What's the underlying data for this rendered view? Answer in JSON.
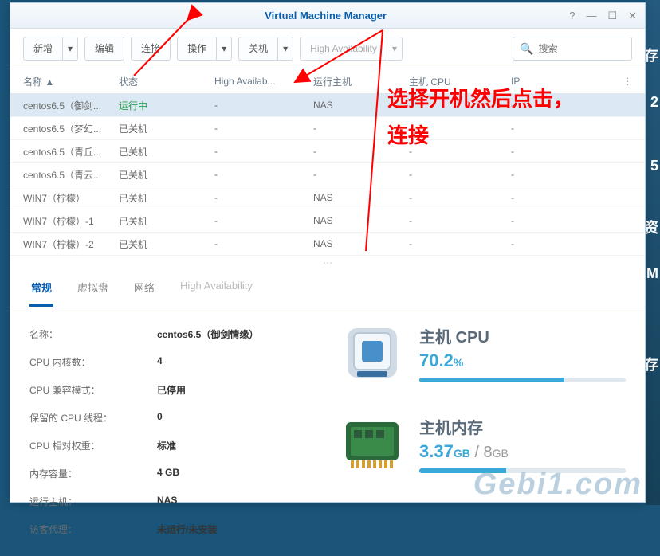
{
  "window": {
    "title": "Virtual Machine Manager"
  },
  "toolbar": {
    "new": "新增",
    "edit": "编辑",
    "connect": "连接",
    "action": "操作",
    "shutdown": "关机",
    "ha": "High Availability",
    "search_placeholder": "搜索"
  },
  "table": {
    "headers": {
      "name": "名称 ▲",
      "state": "状态",
      "ha": "High Availab...",
      "host": "运行主机",
      "cpu": "主机 CPU",
      "ip": "IP",
      "more": "⋮"
    },
    "rows": [
      {
        "name": "centos6.5（御剑...",
        "state": "运行中",
        "running": true,
        "ha": "-",
        "host": "NAS",
        "cpu": "",
        "ip": "-"
      },
      {
        "name": "centos6.5（梦幻...",
        "state": "已关机",
        "running": false,
        "ha": "-",
        "host": "-",
        "cpu": "-",
        "ip": "-"
      },
      {
        "name": "centos6.5（青丘...",
        "state": "已关机",
        "running": false,
        "ha": "-",
        "host": "-",
        "cpu": "-",
        "ip": "-"
      },
      {
        "name": "centos6.5（青云...",
        "state": "已关机",
        "running": false,
        "ha": "-",
        "host": "-",
        "cpu": "-",
        "ip": "-"
      },
      {
        "name": "WIN7（柠檬）",
        "state": "已关机",
        "running": false,
        "ha": "-",
        "host": "NAS",
        "cpu": "-",
        "ip": "-"
      },
      {
        "name": "WIN7（柠檬）-1",
        "state": "已关机",
        "running": false,
        "ha": "-",
        "host": "NAS",
        "cpu": "-",
        "ip": "-"
      },
      {
        "name": "WIN7（柠檬）-2",
        "state": "已关机",
        "running": false,
        "ha": "-",
        "host": "NAS",
        "cpu": "-",
        "ip": "-"
      }
    ]
  },
  "tabs": {
    "general": "常规",
    "vdisk": "虚拟盘",
    "network": "网络",
    "ha": "High Availability"
  },
  "props": {
    "name_l": "名称：",
    "name_v": "centos6.5（御剑情缘）",
    "cores_l": "CPU 内核数：",
    "cores_v": "4",
    "compat_l": "CPU 兼容模式：",
    "compat_v": "已停用",
    "reserved_l": "保留的 CPU 线程：",
    "reserved_v": "0",
    "weight_l": "CPU 相对权重：",
    "weight_v": "标准",
    "mem_l": "内存容量：",
    "mem_v": "4 GB",
    "host_l": "运行主机：",
    "host_v": "NAS",
    "guest_l": "访客代理：",
    "guest_v": "未运行/未安装"
  },
  "stats": {
    "cpu_title": "主机 CPU",
    "cpu_val": "70.2",
    "cpu_unit": "%",
    "mem_title": "主机内存",
    "mem_used": "3.37",
    "mem_used_unit": "GB",
    "mem_sep": " / ",
    "mem_total": "8",
    "mem_total_unit": "GB"
  },
  "annotation": {
    "line1": "选择开机然后点击，",
    "line2": "连接"
  },
  "watermark": "Gebi1.com",
  "sidebar": {
    "b1": "存",
    "n1": "2",
    "n2": "5",
    "b2": "资",
    "b3": "M",
    "b4": "存"
  }
}
